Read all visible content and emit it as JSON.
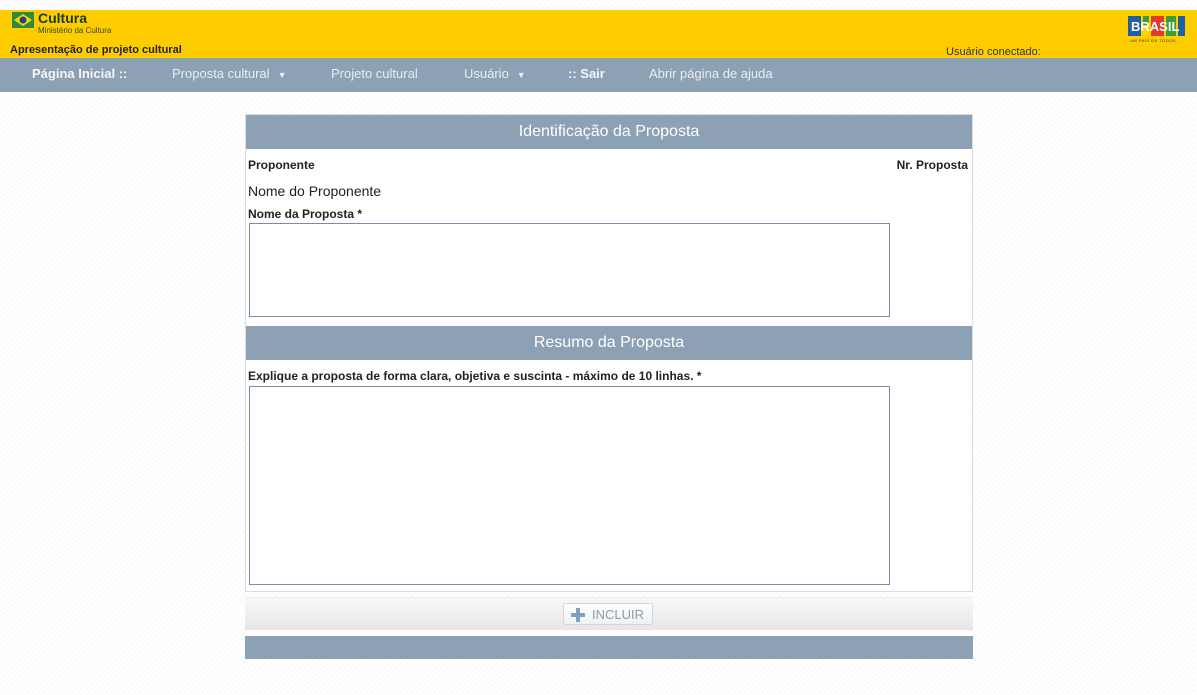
{
  "header": {
    "brand": "Cultura",
    "ministry": "Ministério da Cultura",
    "app_title": "Apresentação de projeto cultural",
    "user_connected": "Usuário conectado:",
    "gov_logo_text": "BRASIL",
    "gov_tagline": "UM PAÍS DE TODOS"
  },
  "nav": {
    "items": [
      {
        "label": "Página Inicial ::"
      },
      {
        "label": "Proposta cultural"
      },
      {
        "label": "Projeto cultural"
      },
      {
        "label": "Usuário"
      },
      {
        "label": ":: Sair"
      },
      {
        "label": "Abrir página de ajuda"
      }
    ]
  },
  "identificacao": {
    "title": "Identificação da Proposta",
    "proponente_label": "Proponente",
    "nr_proposta_label": "Nr. Proposta",
    "proponente_value": "Nome do Proponente",
    "nome_proposta_label": "Nome da Proposta *",
    "nome_proposta_value": ""
  },
  "resumo": {
    "title": "Resumo da Proposta",
    "instruction": "Explique a proposta de forma clara, objetiva e suscinta - máximo de 10 linhas. *",
    "value": ""
  },
  "actions": {
    "incluir_label": "INCLUIR"
  },
  "colors": {
    "header_yellow": "#ffcc00",
    "nav_blue": "#8ca1b4"
  }
}
